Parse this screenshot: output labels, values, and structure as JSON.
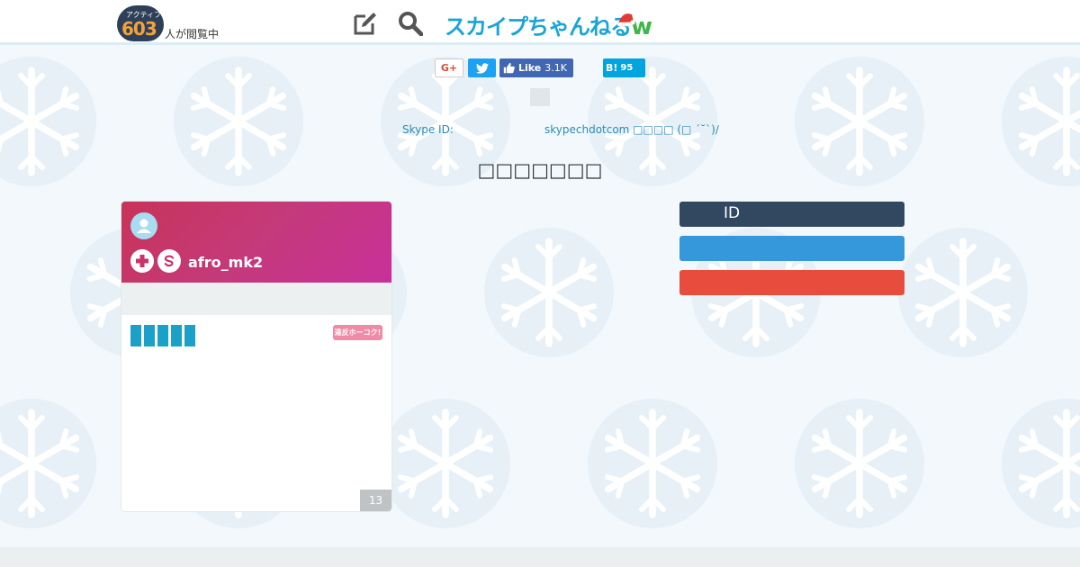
{
  "header": {
    "active_label": "アクティブ",
    "active_count": "603",
    "active_suffix": "人が閲覧中",
    "site_logo": "スカイプちゃんねる",
    "site_logo_w": "w"
  },
  "share": {
    "gplus_label": "G+",
    "facebook_label": "Like",
    "facebook_count": "3.1K",
    "hatena_label": "B!",
    "hatena_count": "95"
  },
  "skype": {
    "label": "Skype ID:",
    "value": "skypechdotcom □□□□ (□ ´˘`)/"
  },
  "page_title": "□□□□□□□",
  "card": {
    "username": "afro_mk2",
    "report_badge": "違反ホーコク!",
    "count": "13"
  },
  "actions": {
    "id_button": "ID"
  },
  "colors": {
    "accent": "#18a5d6",
    "card_gradient_start": "#c83358",
    "card_gradient_end": "#c8309a",
    "id_button": "#324760",
    "blue_button": "#3498db",
    "red_button": "#e74c3c"
  }
}
